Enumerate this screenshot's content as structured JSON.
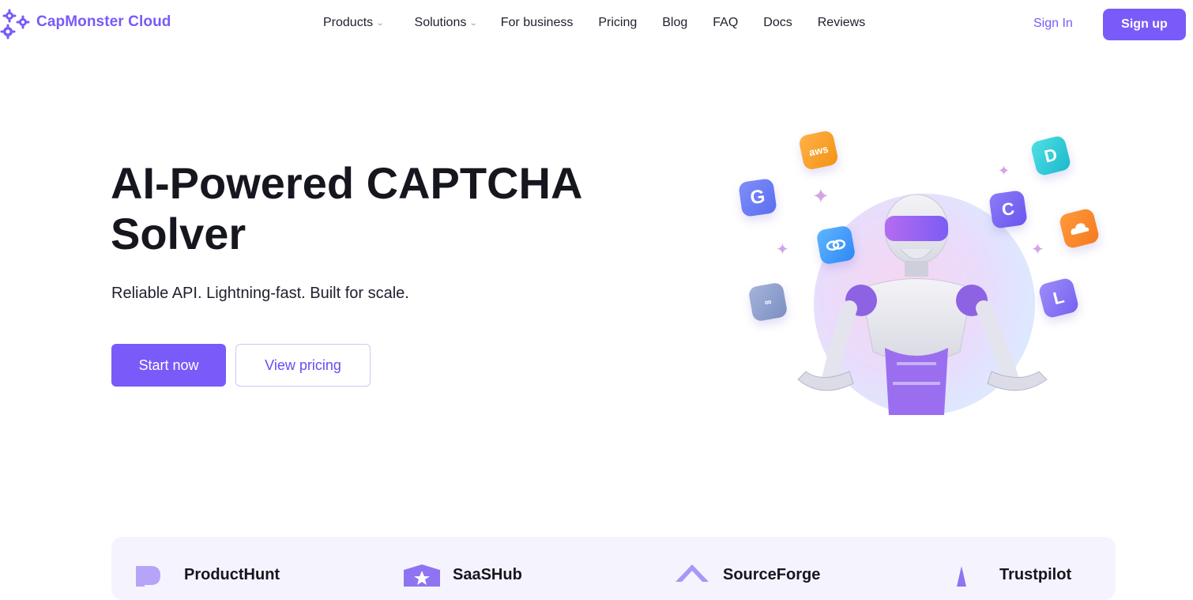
{
  "brand": {
    "name": "CapMonster Cloud",
    "accent": "#7a5af8",
    "icon": "gears-icon"
  },
  "nav": {
    "items": [
      {
        "label": "Products",
        "has_dropdown": true
      },
      {
        "label": "Solutions",
        "has_dropdown": true
      },
      {
        "label": "For business",
        "has_dropdown": false
      },
      {
        "label": "Pricing",
        "has_dropdown": false
      },
      {
        "label": "Blog",
        "has_dropdown": false
      },
      {
        "label": "FAQ",
        "has_dropdown": false
      },
      {
        "label": "Docs",
        "has_dropdown": false
      },
      {
        "label": "Reviews",
        "has_dropdown": false
      }
    ],
    "sign_in": "Sign In",
    "sign_up": "Sign up"
  },
  "hero": {
    "title": "AI-Powered CAPTCHA Solver",
    "subtitle": "Reliable API. Lightning-fast. Built for scale.",
    "primary_cta": "Start now",
    "secondary_cta": "View pricing"
  },
  "illustration": {
    "icons": [
      {
        "name": "aws-icon",
        "glyph": "aws"
      },
      {
        "name": "google-g-icon",
        "glyph": "G"
      },
      {
        "name": "binance-icon",
        "glyph": ""
      },
      {
        "name": "geetest-icon",
        "glyph": ""
      },
      {
        "name": "captcha-c-icon",
        "glyph": "C"
      },
      {
        "name": "d-logo-icon",
        "glyph": "D"
      },
      {
        "name": "cloudflare-icon",
        "glyph": ""
      },
      {
        "name": "l-logo-icon",
        "glyph": "L"
      }
    ]
  },
  "reviews": {
    "items": [
      {
        "name": "ProductHunt",
        "icon": "producthunt-icon"
      },
      {
        "name": "SaaSHub",
        "icon": "saashub-icon"
      },
      {
        "name": "SourceForge",
        "icon": "sourceforge-icon"
      },
      {
        "name": "Trustpilot",
        "icon": "trustpilot-icon"
      }
    ]
  }
}
